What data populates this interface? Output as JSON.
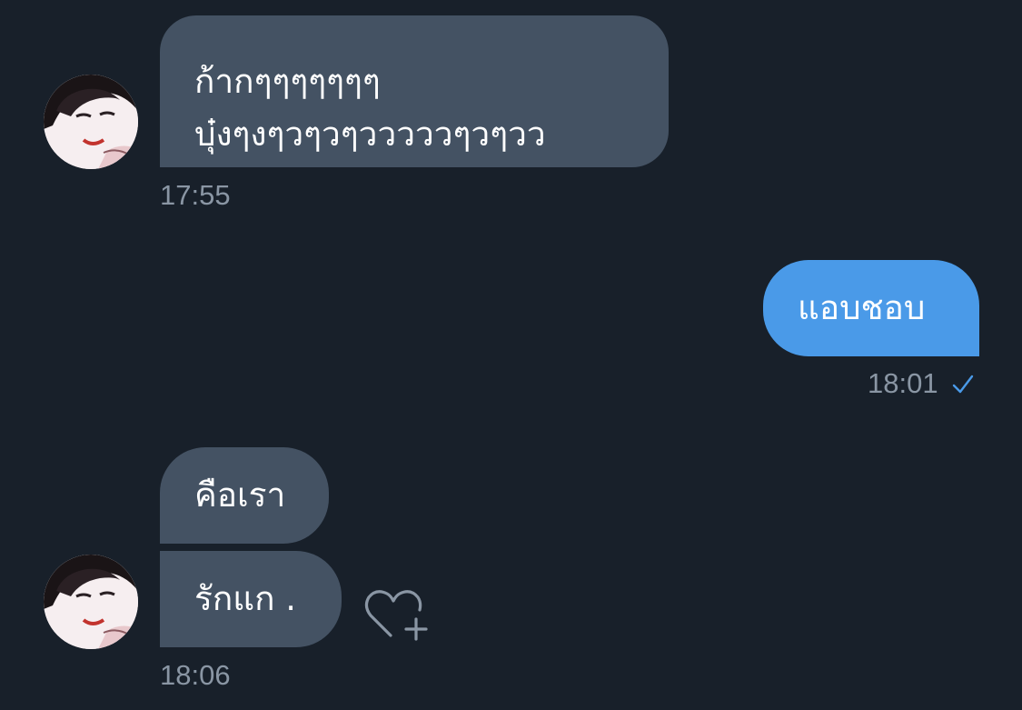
{
  "conversation": {
    "messages": [
      {
        "direction": "incoming",
        "lines": [
          "ก้ากๆๆๆๆๆๆๆ",
          "บุ๋งๆงๆวๆวๆวววววๆวๆวว"
        ],
        "time": "17:55"
      },
      {
        "direction": "outgoing",
        "text": "แอบชอบ",
        "time": "18:01",
        "status_icon": "check-icon"
      },
      {
        "direction": "incoming",
        "text": "คือเรา"
      },
      {
        "direction": "incoming",
        "text": "รักแก .",
        "time": "18:06",
        "reaction_icon": "heart-plus-icon"
      }
    ]
  },
  "colors": {
    "background": "#18202a",
    "incoming_bubble": "#445263",
    "outgoing_bubble": "#4a9ae8",
    "timestamp": "#8a96a4"
  }
}
